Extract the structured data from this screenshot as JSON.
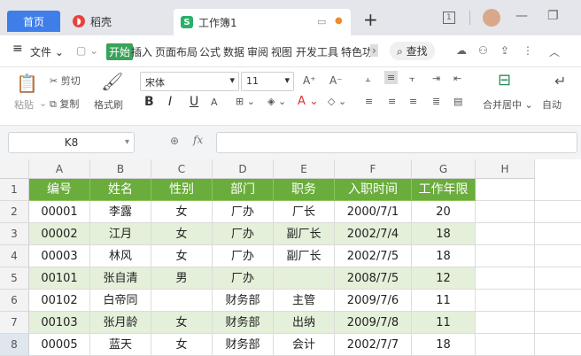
{
  "titlebar": {
    "tab_home": "首页",
    "tab_daoke": "稻壳",
    "tab_doc": "工作簿1",
    "new_tab": "+",
    "window_count": "1"
  },
  "menu": {
    "hamburger": "≡",
    "file": "文件",
    "items": [
      "开始",
      "插入",
      "页面布局",
      "公式",
      "数据",
      "审阅",
      "视图",
      "开发工具",
      "特色功"
    ],
    "search": "查找"
  },
  "ribbon": {
    "paste": "粘贴",
    "cut": "剪切",
    "copy": "复制",
    "format_painter": "格式刷",
    "font_name": "宋体",
    "font_size": "11",
    "bold": "B",
    "italic": "I",
    "underline": "U",
    "merge_center": "合并居中",
    "auto_wrap": "自动"
  },
  "formula_bar": {
    "name_box": "K8",
    "fx": "fx"
  },
  "sheet": {
    "columns": [
      "A",
      "B",
      "C",
      "D",
      "E",
      "F",
      "G",
      "H"
    ],
    "rows": [
      "1",
      "2",
      "3",
      "4",
      "5",
      "6",
      "7",
      "8"
    ],
    "header": [
      "编号",
      "姓名",
      "性别",
      "部门",
      "职务",
      "入职时间",
      "工作年限"
    ],
    "data": [
      [
        "00001",
        "李露",
        "女",
        "厂办",
        "厂长",
        "2000/7/1",
        "20"
      ],
      [
        "00002",
        "江月",
        "女",
        "厂办",
        "副厂长",
        "2002/7/4",
        "18"
      ],
      [
        "00003",
        "林风",
        "女",
        "厂办",
        "副厂长",
        "2002/7/5",
        "18"
      ],
      [
        "00101",
        "张自清",
        "男",
        "厂办",
        "",
        "2008/7/5",
        "12"
      ],
      [
        "00102",
        "白帝同",
        "",
        "财务部",
        "主管",
        "2009/7/6",
        "11"
      ],
      [
        "00103",
        "张月龄",
        "女",
        "财务部",
        "出纳",
        "2009/7/8",
        "11"
      ],
      [
        "00005",
        "蓝天",
        "女",
        "财务部",
        "会计",
        "2002/7/7",
        "18"
      ]
    ]
  },
  "colors": {
    "header_green": "#6aad3c",
    "band_green": "#e4f0da",
    "accent_blue": "#3f7ee8",
    "active_tab_green": "#3aa35b"
  }
}
